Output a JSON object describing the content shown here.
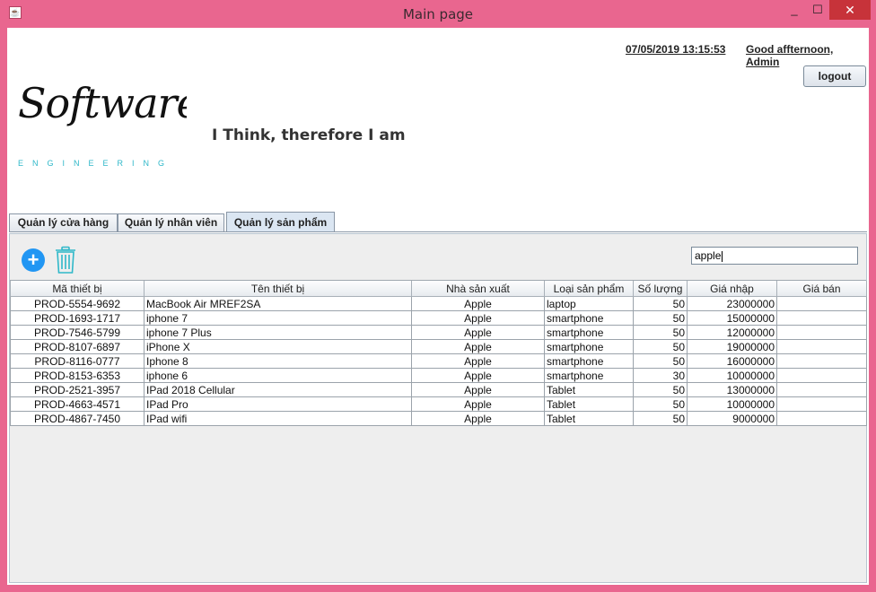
{
  "window": {
    "title": "Main page",
    "minimize": "_",
    "maximize": "☐",
    "close": "✕"
  },
  "header": {
    "logo_main": "Software",
    "logo_sub": "ENGINEERING",
    "motto": "I Think, therefore I am",
    "datetime": "07/05/2019 13:15:53",
    "greeting": "Good affternoon, Admin",
    "logout_label": "logout"
  },
  "tabs": [
    {
      "label": "Quản lý cửa hàng",
      "active": false
    },
    {
      "label": "Quản lý nhân viên",
      "active": false
    },
    {
      "label": "Quản lý sản phẩm",
      "active": true
    }
  ],
  "toolbar": {
    "add_icon": "plus-circle-icon",
    "delete_icon": "trash-icon"
  },
  "search": {
    "value": "apple"
  },
  "table": {
    "columns": [
      "Mã thiết bị",
      "Tên thiết bị",
      "Nhà sản xuất",
      "Loại sản phẩm",
      "Số lượng",
      "Giá nhập",
      "Giá bán"
    ],
    "rows": [
      [
        "PROD-5554-9692",
        "MacBook Air MREF2SA",
        "Apple",
        "laptop",
        "50",
        "23000000",
        ""
      ],
      [
        "PROD-1693-1717",
        "iphone 7",
        "Apple",
        "smartphone",
        "50",
        "15000000",
        ""
      ],
      [
        "PROD-7546-5799",
        "iphone 7 Plus",
        "Apple",
        "smartphone",
        "50",
        "12000000",
        ""
      ],
      [
        "PROD-8107-6897",
        "iPhone X",
        "Apple",
        "smartphone",
        "50",
        "19000000",
        ""
      ],
      [
        "PROD-8116-0777",
        "Iphone 8",
        "Apple",
        "smartphone",
        "50",
        "16000000",
        ""
      ],
      [
        "PROD-8153-6353",
        "iphone 6",
        "Apple",
        "smartphone",
        "30",
        "10000000",
        ""
      ],
      [
        "PROD-2521-3957",
        "IPad 2018 Cellular",
        "Apple",
        "Tablet",
        "50",
        "13000000",
        ""
      ],
      [
        "PROD-4663-4571",
        "IPad Pro",
        "Apple",
        "Tablet",
        "50",
        "10000000",
        ""
      ],
      [
        "PROD-4867-7450",
        "IPad wifi",
        "Apple",
        "Tablet",
        "50",
        "9000000",
        ""
      ]
    ]
  },
  "colors": {
    "window_frame": "#e9668f",
    "add_button": "#2196f3",
    "trash": "#2fb8c9",
    "close_button": "#c7333a",
    "logo_accent": "#2fb8c9"
  }
}
